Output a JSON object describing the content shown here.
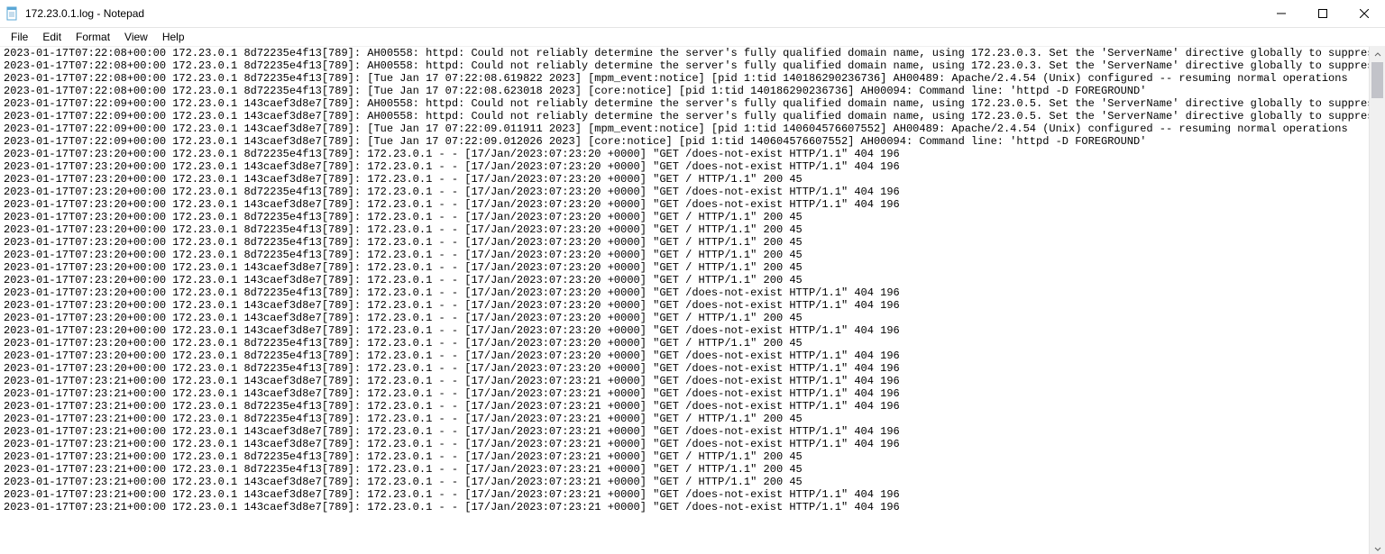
{
  "titlebar": {
    "title": "172.23.0.1.log - Notepad"
  },
  "menu": {
    "file": "File",
    "edit": "Edit",
    "format": "Format",
    "view": "View",
    "help": "Help"
  },
  "log_lines": [
    "2023-01-17T07:22:08+00:00 172.23.0.1 8d72235e4f13[789]: AH00558: httpd: Could not reliably determine the server's fully qualified domain name, using 172.23.0.3. Set the 'ServerName' directive globally to suppress this mess",
    "2023-01-17T07:22:08+00:00 172.23.0.1 8d72235e4f13[789]: AH00558: httpd: Could not reliably determine the server's fully qualified domain name, using 172.23.0.3. Set the 'ServerName' directive globally to suppress this mess",
    "2023-01-17T07:22:08+00:00 172.23.0.1 8d72235e4f13[789]: [Tue Jan 17 07:22:08.619822 2023] [mpm_event:notice] [pid 1:tid 140186290236736] AH00489: Apache/2.4.54 (Unix) configured -- resuming normal operations",
    "2023-01-17T07:22:08+00:00 172.23.0.1 8d72235e4f13[789]: [Tue Jan 17 07:22:08.623018 2023] [core:notice] [pid 1:tid 140186290236736] AH00094: Command line: 'httpd -D FOREGROUND'",
    "2023-01-17T07:22:09+00:00 172.23.0.1 143caef3d8e7[789]: AH00558: httpd: Could not reliably determine the server's fully qualified domain name, using 172.23.0.5. Set the 'ServerName' directive globally to suppress this mess",
    "2023-01-17T07:22:09+00:00 172.23.0.1 143caef3d8e7[789]: AH00558: httpd: Could not reliably determine the server's fully qualified domain name, using 172.23.0.5. Set the 'ServerName' directive globally to suppress this mess",
    "2023-01-17T07:22:09+00:00 172.23.0.1 143caef3d8e7[789]: [Tue Jan 17 07:22:09.011911 2023] [mpm_event:notice] [pid 1:tid 140604576607552] AH00489: Apache/2.4.54 (Unix) configured -- resuming normal operations",
    "2023-01-17T07:22:09+00:00 172.23.0.1 143caef3d8e7[789]: [Tue Jan 17 07:22:09.012026 2023] [core:notice] [pid 1:tid 140604576607552] AH00094: Command line: 'httpd -D FOREGROUND'",
    "2023-01-17T07:23:20+00:00 172.23.0.1 8d72235e4f13[789]: 172.23.0.1 - - [17/Jan/2023:07:23:20 +0000] \"GET /does-not-exist HTTP/1.1\" 404 196",
    "2023-01-17T07:23:20+00:00 172.23.0.1 143caef3d8e7[789]: 172.23.0.1 - - [17/Jan/2023:07:23:20 +0000] \"GET /does-not-exist HTTP/1.1\" 404 196",
    "2023-01-17T07:23:20+00:00 172.23.0.1 143caef3d8e7[789]: 172.23.0.1 - - [17/Jan/2023:07:23:20 +0000] \"GET / HTTP/1.1\" 200 45",
    "2023-01-17T07:23:20+00:00 172.23.0.1 8d72235e4f13[789]: 172.23.0.1 - - [17/Jan/2023:07:23:20 +0000] \"GET /does-not-exist HTTP/1.1\" 404 196",
    "2023-01-17T07:23:20+00:00 172.23.0.1 143caef3d8e7[789]: 172.23.0.1 - - [17/Jan/2023:07:23:20 +0000] \"GET /does-not-exist HTTP/1.1\" 404 196",
    "2023-01-17T07:23:20+00:00 172.23.0.1 8d72235e4f13[789]: 172.23.0.1 - - [17/Jan/2023:07:23:20 +0000] \"GET / HTTP/1.1\" 200 45",
    "2023-01-17T07:23:20+00:00 172.23.0.1 8d72235e4f13[789]: 172.23.0.1 - - [17/Jan/2023:07:23:20 +0000] \"GET / HTTP/1.1\" 200 45",
    "2023-01-17T07:23:20+00:00 172.23.0.1 8d72235e4f13[789]: 172.23.0.1 - - [17/Jan/2023:07:23:20 +0000] \"GET / HTTP/1.1\" 200 45",
    "2023-01-17T07:23:20+00:00 172.23.0.1 8d72235e4f13[789]: 172.23.0.1 - - [17/Jan/2023:07:23:20 +0000] \"GET / HTTP/1.1\" 200 45",
    "2023-01-17T07:23:20+00:00 172.23.0.1 143caef3d8e7[789]: 172.23.0.1 - - [17/Jan/2023:07:23:20 +0000] \"GET / HTTP/1.1\" 200 45",
    "2023-01-17T07:23:20+00:00 172.23.0.1 143caef3d8e7[789]: 172.23.0.1 - - [17/Jan/2023:07:23:20 +0000] \"GET / HTTP/1.1\" 200 45",
    "2023-01-17T07:23:20+00:00 172.23.0.1 8d72235e4f13[789]: 172.23.0.1 - - [17/Jan/2023:07:23:20 +0000] \"GET /does-not-exist HTTP/1.1\" 404 196",
    "2023-01-17T07:23:20+00:00 172.23.0.1 143caef3d8e7[789]: 172.23.0.1 - - [17/Jan/2023:07:23:20 +0000] \"GET /does-not-exist HTTP/1.1\" 404 196",
    "2023-01-17T07:23:20+00:00 172.23.0.1 143caef3d8e7[789]: 172.23.0.1 - - [17/Jan/2023:07:23:20 +0000] \"GET / HTTP/1.1\" 200 45",
    "2023-01-17T07:23:20+00:00 172.23.0.1 143caef3d8e7[789]: 172.23.0.1 - - [17/Jan/2023:07:23:20 +0000] \"GET /does-not-exist HTTP/1.1\" 404 196",
    "2023-01-17T07:23:20+00:00 172.23.0.1 8d72235e4f13[789]: 172.23.0.1 - - [17/Jan/2023:07:23:20 +0000] \"GET / HTTP/1.1\" 200 45",
    "2023-01-17T07:23:20+00:00 172.23.0.1 8d72235e4f13[789]: 172.23.0.1 - - [17/Jan/2023:07:23:20 +0000] \"GET /does-not-exist HTTP/1.1\" 404 196",
    "2023-01-17T07:23:20+00:00 172.23.0.1 8d72235e4f13[789]: 172.23.0.1 - - [17/Jan/2023:07:23:20 +0000] \"GET /does-not-exist HTTP/1.1\" 404 196",
    "2023-01-17T07:23:21+00:00 172.23.0.1 143caef3d8e7[789]: 172.23.0.1 - - [17/Jan/2023:07:23:21 +0000] \"GET /does-not-exist HTTP/1.1\" 404 196",
    "2023-01-17T07:23:21+00:00 172.23.0.1 143caef3d8e7[789]: 172.23.0.1 - - [17/Jan/2023:07:23:21 +0000] \"GET /does-not-exist HTTP/1.1\" 404 196",
    "2023-01-17T07:23:21+00:00 172.23.0.1 8d72235e4f13[789]: 172.23.0.1 - - [17/Jan/2023:07:23:21 +0000] \"GET /does-not-exist HTTP/1.1\" 404 196",
    "2023-01-17T07:23:21+00:00 172.23.0.1 8d72235e4f13[789]: 172.23.0.1 - - [17/Jan/2023:07:23:21 +0000] \"GET / HTTP/1.1\" 200 45",
    "2023-01-17T07:23:21+00:00 172.23.0.1 143caef3d8e7[789]: 172.23.0.1 - - [17/Jan/2023:07:23:21 +0000] \"GET /does-not-exist HTTP/1.1\" 404 196",
    "2023-01-17T07:23:21+00:00 172.23.0.1 143caef3d8e7[789]: 172.23.0.1 - - [17/Jan/2023:07:23:21 +0000] \"GET /does-not-exist HTTP/1.1\" 404 196",
    "2023-01-17T07:23:21+00:00 172.23.0.1 8d72235e4f13[789]: 172.23.0.1 - - [17/Jan/2023:07:23:21 +0000] \"GET / HTTP/1.1\" 200 45",
    "2023-01-17T07:23:21+00:00 172.23.0.1 8d72235e4f13[789]: 172.23.0.1 - - [17/Jan/2023:07:23:21 +0000] \"GET / HTTP/1.1\" 200 45",
    "2023-01-17T07:23:21+00:00 172.23.0.1 143caef3d8e7[789]: 172.23.0.1 - - [17/Jan/2023:07:23:21 +0000] \"GET / HTTP/1.1\" 200 45",
    "2023-01-17T07:23:21+00:00 172.23.0.1 143caef3d8e7[789]: 172.23.0.1 - - [17/Jan/2023:07:23:21 +0000] \"GET /does-not-exist HTTP/1.1\" 404 196",
    "2023-01-17T07:23:21+00:00 172.23.0.1 143caef3d8e7[789]: 172.23.0.1 - - [17/Jan/2023:07:23:21 +0000] \"GET /does-not-exist HTTP/1.1\" 404 196"
  ]
}
